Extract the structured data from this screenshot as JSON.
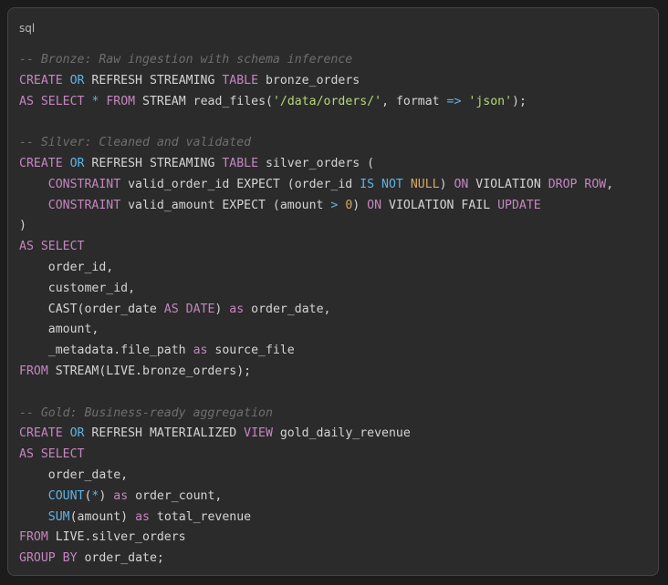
{
  "code_block": {
    "language": "sql",
    "lines": [
      [
        {
          "t": "comment",
          "v": "-- Bronze: Raw ingestion with schema inference"
        }
      ],
      [
        {
          "t": "kw",
          "v": "CREATE"
        },
        {
          "t": "plain",
          "v": " "
        },
        {
          "t": "type",
          "v": "OR"
        },
        {
          "t": "plain",
          "v": " REFRESH STREAMING "
        },
        {
          "t": "kw",
          "v": "TABLE"
        },
        {
          "t": "plain",
          "v": " bronze_orders"
        }
      ],
      [
        {
          "t": "kw",
          "v": "AS"
        },
        {
          "t": "plain",
          "v": " "
        },
        {
          "t": "kw",
          "v": "SELECT"
        },
        {
          "t": "plain",
          "v": " "
        },
        {
          "t": "op",
          "v": "*"
        },
        {
          "t": "plain",
          "v": " "
        },
        {
          "t": "kw",
          "v": "FROM"
        },
        {
          "t": "plain",
          "v": " STREAM read_files("
        },
        {
          "t": "str",
          "v": "'/data/orders/'"
        },
        {
          "t": "plain",
          "v": ", format "
        },
        {
          "t": "op",
          "v": "=>"
        },
        {
          "t": "plain",
          "v": " "
        },
        {
          "t": "str",
          "v": "'json'"
        },
        {
          "t": "plain",
          "v": ");"
        }
      ],
      [],
      [
        {
          "t": "comment",
          "v": "-- Silver: Cleaned and validated"
        }
      ],
      [
        {
          "t": "kw",
          "v": "CREATE"
        },
        {
          "t": "plain",
          "v": " "
        },
        {
          "t": "type",
          "v": "OR"
        },
        {
          "t": "plain",
          "v": " REFRESH STREAMING "
        },
        {
          "t": "kw",
          "v": "TABLE"
        },
        {
          "t": "plain",
          "v": " silver_orders ("
        }
      ],
      [
        {
          "t": "plain",
          "v": "    "
        },
        {
          "t": "kw",
          "v": "CONSTRAINT"
        },
        {
          "t": "plain",
          "v": " valid_order_id EXPECT (order_id "
        },
        {
          "t": "type",
          "v": "IS"
        },
        {
          "t": "plain",
          "v": " "
        },
        {
          "t": "type",
          "v": "NOT"
        },
        {
          "t": "plain",
          "v": " "
        },
        {
          "t": "num",
          "v": "NULL"
        },
        {
          "t": "plain",
          "v": ") "
        },
        {
          "t": "kw",
          "v": "ON"
        },
        {
          "t": "plain",
          "v": " VIOLATION "
        },
        {
          "t": "kw",
          "v": "DROP"
        },
        {
          "t": "plain",
          "v": " "
        },
        {
          "t": "kw",
          "v": "ROW"
        },
        {
          "t": "plain",
          "v": ","
        }
      ],
      [
        {
          "t": "plain",
          "v": "    "
        },
        {
          "t": "kw",
          "v": "CONSTRAINT"
        },
        {
          "t": "plain",
          "v": " valid_amount EXPECT (amount "
        },
        {
          "t": "op",
          "v": ">"
        },
        {
          "t": "plain",
          "v": " "
        },
        {
          "t": "num",
          "v": "0"
        },
        {
          "t": "plain",
          "v": ") "
        },
        {
          "t": "kw",
          "v": "ON"
        },
        {
          "t": "plain",
          "v": " VIOLATION FAIL "
        },
        {
          "t": "kw",
          "v": "UPDATE"
        }
      ],
      [
        {
          "t": "plain",
          "v": ")"
        }
      ],
      [
        {
          "t": "kw",
          "v": "AS"
        },
        {
          "t": "plain",
          "v": " "
        },
        {
          "t": "kw",
          "v": "SELECT"
        }
      ],
      [
        {
          "t": "plain",
          "v": "    order_id,"
        }
      ],
      [
        {
          "t": "plain",
          "v": "    customer_id,"
        }
      ],
      [
        {
          "t": "plain",
          "v": "    CAST(order_date "
        },
        {
          "t": "kw",
          "v": "AS"
        },
        {
          "t": "plain",
          "v": " "
        },
        {
          "t": "kw",
          "v": "DATE"
        },
        {
          "t": "plain",
          "v": ") "
        },
        {
          "t": "kw",
          "v": "as"
        },
        {
          "t": "plain",
          "v": " order_date,"
        }
      ],
      [
        {
          "t": "plain",
          "v": "    amount,"
        }
      ],
      [
        {
          "t": "plain",
          "v": "    _metadata.file_path "
        },
        {
          "t": "kw",
          "v": "as"
        },
        {
          "t": "plain",
          "v": " source_file"
        }
      ],
      [
        {
          "t": "kw",
          "v": "FROM"
        },
        {
          "t": "plain",
          "v": " STREAM(LIVE.bronze_orders);"
        }
      ],
      [],
      [
        {
          "t": "comment",
          "v": "-- Gold: Business-ready aggregation"
        }
      ],
      [
        {
          "t": "kw",
          "v": "CREATE"
        },
        {
          "t": "plain",
          "v": " "
        },
        {
          "t": "type",
          "v": "OR"
        },
        {
          "t": "plain",
          "v": " REFRESH MATERIALIZED "
        },
        {
          "t": "kw",
          "v": "VIEW"
        },
        {
          "t": "plain",
          "v": " gold_daily_revenue"
        }
      ],
      [
        {
          "t": "kw",
          "v": "AS"
        },
        {
          "t": "plain",
          "v": " "
        },
        {
          "t": "kw",
          "v": "SELECT"
        }
      ],
      [
        {
          "t": "plain",
          "v": "    order_date,"
        }
      ],
      [
        {
          "t": "plain",
          "v": "    "
        },
        {
          "t": "type",
          "v": "COUNT"
        },
        {
          "t": "plain",
          "v": "("
        },
        {
          "t": "op",
          "v": "*"
        },
        {
          "t": "plain",
          "v": ") "
        },
        {
          "t": "kw",
          "v": "as"
        },
        {
          "t": "plain",
          "v": " order_count,"
        }
      ],
      [
        {
          "t": "plain",
          "v": "    "
        },
        {
          "t": "type",
          "v": "SUM"
        },
        {
          "t": "plain",
          "v": "(amount) "
        },
        {
          "t": "kw",
          "v": "as"
        },
        {
          "t": "plain",
          "v": " total_revenue"
        }
      ],
      [
        {
          "t": "kw",
          "v": "FROM"
        },
        {
          "t": "plain",
          "v": " LIVE.silver_orders"
        }
      ],
      [
        {
          "t": "kw",
          "v": "GROUP"
        },
        {
          "t": "plain",
          "v": " "
        },
        {
          "t": "kw",
          "v": "BY"
        },
        {
          "t": "plain",
          "v": " order_date;"
        }
      ]
    ]
  },
  "colors": {
    "background": "#2b2b2b",
    "border": "#444444",
    "comment": "#6e6e6e",
    "keyword": "#c586c0",
    "type": "#5fb3e6",
    "string": "#b5d977",
    "number": "#d7a860",
    "text": "#d4d4d4"
  }
}
